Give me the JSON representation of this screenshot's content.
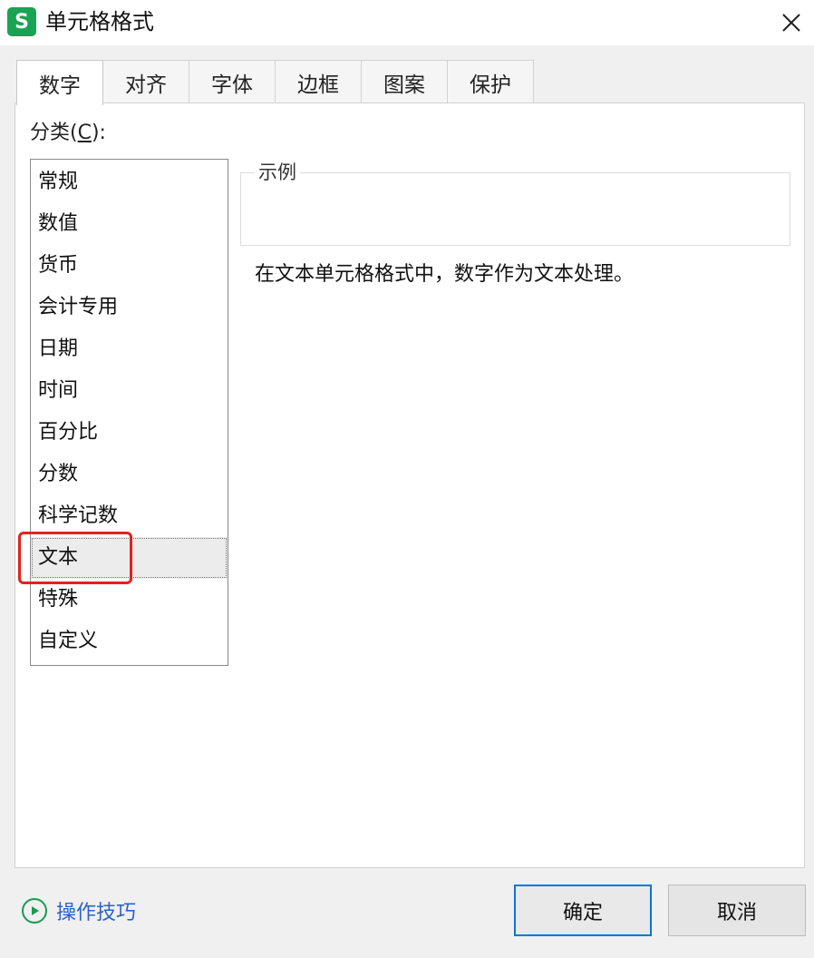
{
  "window": {
    "app_icon_letter": "S",
    "title": "单元格格式",
    "close_icon": "close-icon"
  },
  "tabs": [
    {
      "label": "数字",
      "active": true
    },
    {
      "label": "对齐"
    },
    {
      "label": "字体"
    },
    {
      "label": "边框"
    },
    {
      "label": "图案"
    },
    {
      "label": "保护"
    }
  ],
  "category": {
    "label_prefix": "分类(",
    "label_key": "C",
    "label_suffix": "):",
    "items": [
      "常规",
      "数值",
      "货币",
      "会计专用",
      "日期",
      "时间",
      "百分比",
      "分数",
      "科学记数",
      "文本",
      "特殊",
      "自定义"
    ],
    "selected": "文本"
  },
  "example": {
    "legend": "示例",
    "value": ""
  },
  "description": "在文本单元格格式中，数字作为文本处理。",
  "footer": {
    "tips_label": "操作技巧",
    "ok_label": "确定",
    "cancel_label": "取消"
  },
  "colors": {
    "highlight": "#e0231f",
    "accent": "#0078d7",
    "app_icon": "#1aa354",
    "tips": "#2a62c9"
  }
}
